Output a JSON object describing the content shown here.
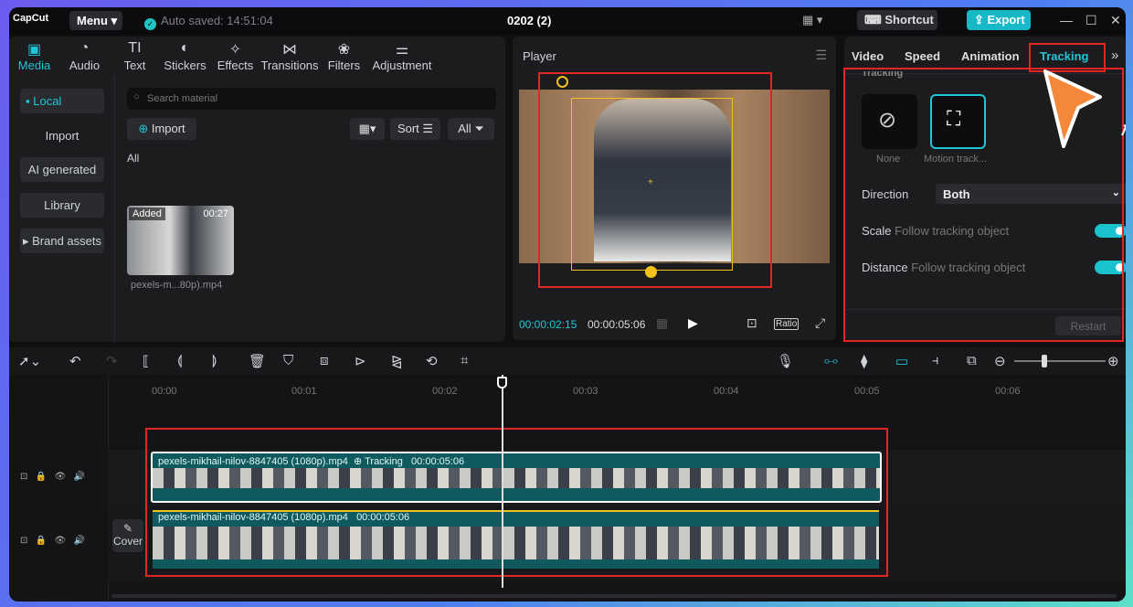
{
  "app": {
    "logo": "CapCut",
    "menu": "Menu",
    "autosave": "Auto saved: 14:51:04",
    "project_title": "0202 (2)",
    "shortcut": "Shortcut",
    "export": "Export"
  },
  "media_tabs": [
    {
      "label": "Media",
      "icon": "media-icon"
    },
    {
      "label": "Audio",
      "icon": "audio-icon"
    },
    {
      "label": "Text",
      "icon": "text-icon"
    },
    {
      "label": "Stickers",
      "icon": "stickers-icon"
    },
    {
      "label": "Effects",
      "icon": "effects-icon"
    },
    {
      "label": "Transitions",
      "icon": "transitions-icon"
    },
    {
      "label": "Filters",
      "icon": "filters-icon"
    },
    {
      "label": "Adjustment",
      "icon": "adjustment-icon"
    }
  ],
  "sidebar": {
    "local": "Local",
    "import": "Import",
    "ai": "AI generated",
    "library": "Library",
    "brand": "Brand assets"
  },
  "media": {
    "search_placeholder": "Search material",
    "import": "Import",
    "sort": "Sort",
    "all_filter": "All",
    "all_label": "All",
    "added": "Added",
    "duration": "00:27",
    "filename": "pexels-m...80p).mp4"
  },
  "player": {
    "title": "Player",
    "current": "00:00:02:15",
    "total": "00:00:05:06",
    "ratio": "Ratio"
  },
  "right_panel": {
    "tabs": [
      "Video",
      "Speed",
      "Animation",
      "Tracking"
    ],
    "section": "Tracking",
    "opt_none": "None",
    "opt_motion": "Motion track...",
    "direction_label": "Direction",
    "direction_value": "Both",
    "scale_label": "Scale",
    "scale_hint": "Follow tracking object",
    "distance_label": "Distance",
    "distance_hint": "Follow tracking object",
    "restart": "Restart"
  },
  "timeline": {
    "ticks": [
      "00:00",
      "00:01",
      "00:02",
      "00:03",
      "00:04",
      "00:05",
      "00:06"
    ],
    "cover": "Cover",
    "clip1": {
      "name": "pexels-mikhail-nilov-8847405 (1080p).mp4",
      "tracking": "Tracking",
      "duration": "00:00:05:06"
    },
    "clip2": {
      "name": "pexels-mikhail-nilov-8847405 (1080p).mp4",
      "duration": "00:00:05:06"
    }
  },
  "colors": {
    "accent": "#1ec6d6",
    "highlight": "#e22525",
    "export": "#17b9c9",
    "tracking_box": "#f2c21b",
    "cursor": "#f4883a"
  }
}
